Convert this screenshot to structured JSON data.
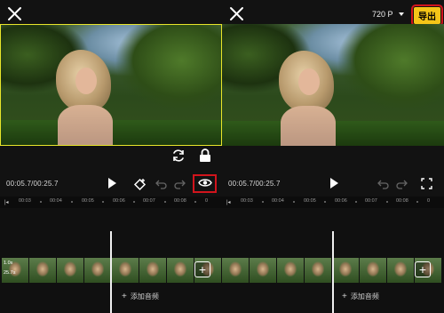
{
  "left_panel": {
    "time_display": "00:05.7/00:25.7",
    "ruler_labels": [
      "00:03",
      "00:04",
      "00:05",
      "00:06",
      "00:07",
      "00:08",
      "0"
    ],
    "strip_label_speed": "1.0x",
    "strip_label_duration": "25.7s",
    "add_audio_label": "添加音频"
  },
  "right_panel": {
    "resolution": "720 P",
    "export_label": "导出",
    "time_display": "00:05.7/00:25.7",
    "ruler_labels": [
      "00:03",
      "00:04",
      "00:05",
      "00:06",
      "00:07",
      "00:08",
      "0"
    ],
    "add_audio_label": "添加音频"
  },
  "icons": {
    "close": "close-icon",
    "play": "play-icon",
    "keyframe": "keyframe-icon",
    "undo": "undo-icon",
    "redo": "redo-icon",
    "preview_eye": "eye-icon",
    "fullscreen": "fullscreen-icon",
    "refresh": "refresh-icon",
    "lock": "lock-icon",
    "add_clip": "plus-icon"
  },
  "colors": {
    "accent_yellow": "#f5c518",
    "highlight_red": "#d1141c",
    "selection_border": "#e8e52a"
  }
}
